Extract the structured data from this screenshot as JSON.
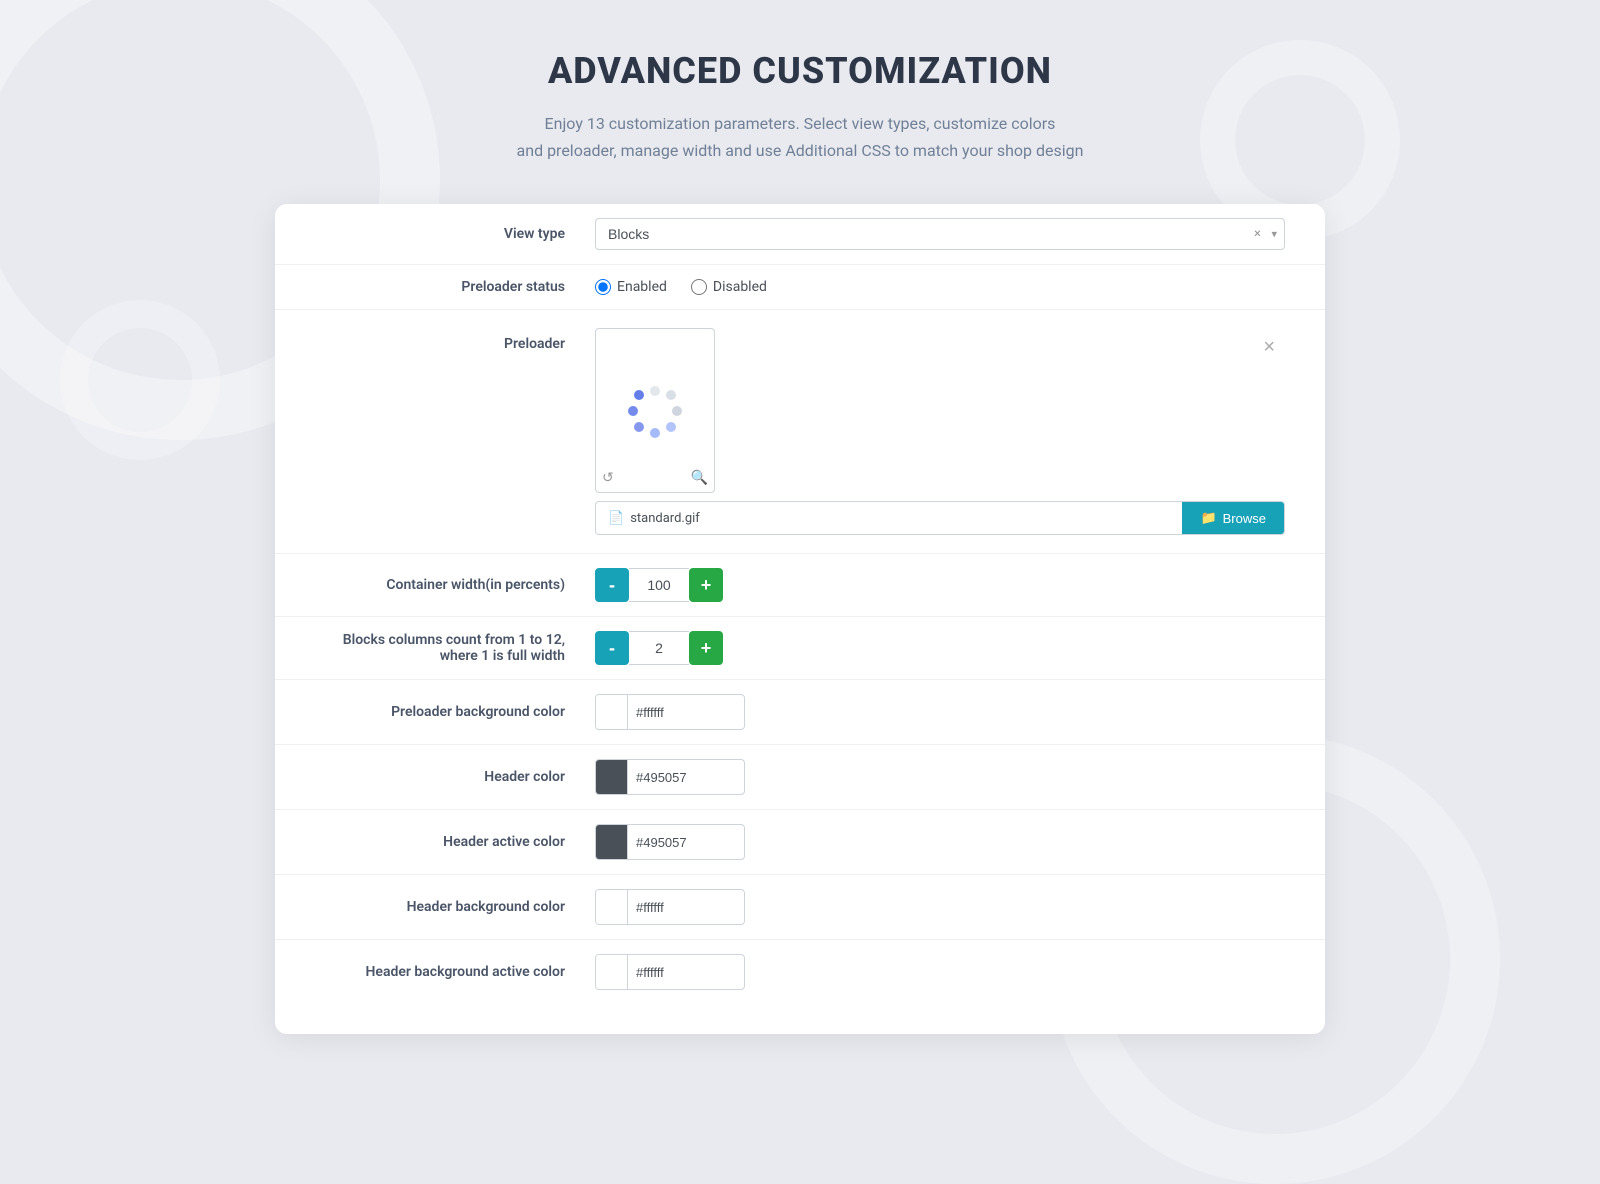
{
  "page": {
    "title": "ADVANCED CUSTOMIZATION",
    "subtitle_line1": "Enjoy 13 customization parameters. Select view types, customize colors",
    "subtitle_line2": "and preloader, manage width and use Additional CSS to match your shop design"
  },
  "form": {
    "view_type_label": "View type",
    "view_type_value": "Blocks",
    "preloader_status_label": "Preloader status",
    "radio_enabled": "Enabled",
    "radio_disabled": "Disabled",
    "preloader_label": "Preloader",
    "preloader_file": "standard.gif",
    "browse_label": "Browse",
    "container_width_label": "Container width(in percents)",
    "container_width_value": "100",
    "blocks_columns_label_line1": "Blocks columns count from 1 to 12,",
    "blocks_columns_label_line2": "where 1 is full width",
    "blocks_columns_value": "2",
    "preloader_bg_color_label": "Preloader background color",
    "preloader_bg_color_value": "#ffffff",
    "header_color_label": "Header color",
    "header_color_value": "#495057",
    "header_active_color_label": "Header active color",
    "header_active_color_value": "#495057",
    "header_bg_color_label": "Header background color",
    "header_bg_color_value": "#ffffff",
    "header_bg_active_color_label": "Header background active color",
    "header_bg_active_color_value": "#ffffff",
    "minus_label": "-",
    "plus_label": "+"
  },
  "colors": {
    "stepper_minus_bg": "#17a2b8",
    "stepper_plus_bg": "#28a745",
    "browse_bg": "#17a2b8",
    "header_swatch_color": "#495057",
    "preloader_bg_swatch": "#ffffff",
    "header_bg_swatch": "#ffffff",
    "header_bg_active_swatch": "#ffffff"
  }
}
